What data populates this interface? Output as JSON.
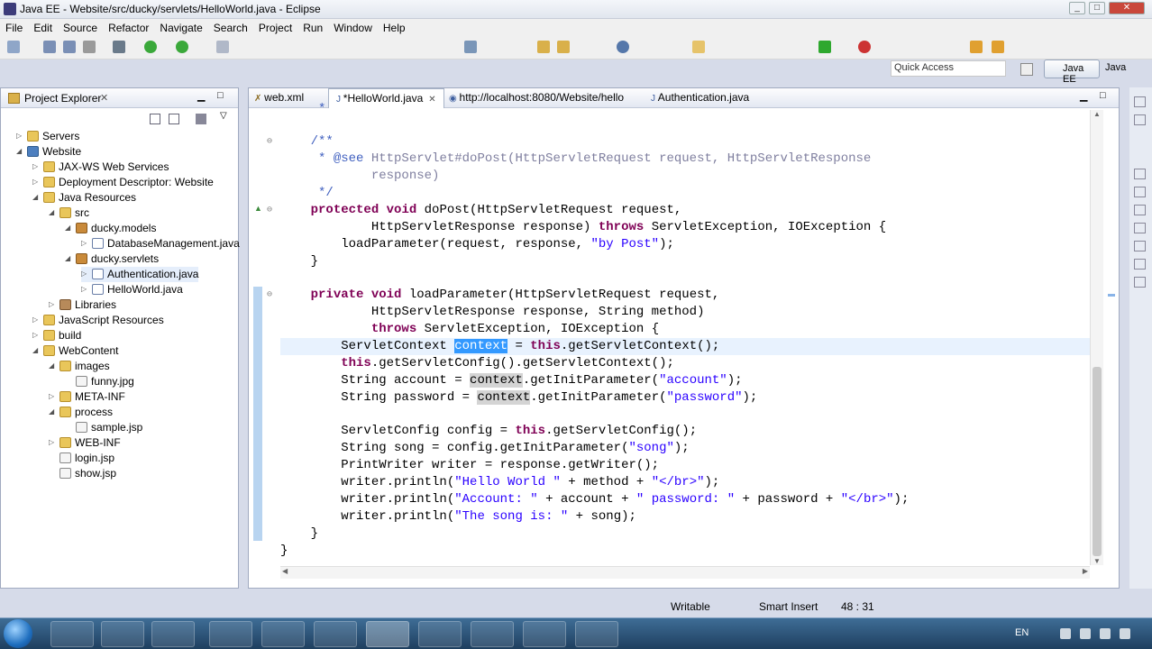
{
  "window": {
    "title": "Java EE - Website/src/ducky/servlets/HelloWorld.java - Eclipse"
  },
  "menu": [
    "File",
    "Edit",
    "Source",
    "Refactor",
    "Navigate",
    "Search",
    "Project",
    "Run",
    "Window",
    "Help"
  ],
  "quick_access": {
    "placeholder": "Quick Access"
  },
  "perspective": {
    "active": "Java EE",
    "other": "Java"
  },
  "explorer": {
    "title": "Project Explorer",
    "nodes": [
      {
        "label": "Servers",
        "icon": "folder"
      },
      {
        "label": "Website",
        "icon": "project"
      },
      {
        "label": "JAX-WS Web Services",
        "icon": "folder"
      },
      {
        "label": "Deployment Descriptor: Website",
        "icon": "folder"
      },
      {
        "label": "Java Resources",
        "icon": "folder"
      },
      {
        "label": "src",
        "icon": "folder"
      },
      {
        "label": "ducky.models",
        "icon": "package"
      },
      {
        "label": "DatabaseManagement.java",
        "icon": "java-file"
      },
      {
        "label": "ducky.servlets",
        "icon": "package"
      },
      {
        "label": "Authentication.java",
        "icon": "java-file"
      },
      {
        "label": "HelloWorld.java",
        "icon": "java-file"
      },
      {
        "label": "Libraries",
        "icon": "library"
      },
      {
        "label": "JavaScript Resources",
        "icon": "folder"
      },
      {
        "label": "build",
        "icon": "folder"
      },
      {
        "label": "WebContent",
        "icon": "folder"
      },
      {
        "label": "images",
        "icon": "folder"
      },
      {
        "label": "funny.jpg",
        "icon": "image-file"
      },
      {
        "label": "META-INF",
        "icon": "folder"
      },
      {
        "label": "process",
        "icon": "folder"
      },
      {
        "label": "sample.jsp",
        "icon": "jsp-file"
      },
      {
        "label": "WEB-INF",
        "icon": "folder"
      },
      {
        "label": "login.jsp",
        "icon": "jsp-file"
      },
      {
        "label": "show.jsp",
        "icon": "jsp-file"
      }
    ]
  },
  "editor": {
    "tabs": [
      {
        "label": "web.xml"
      },
      {
        "label": "*HelloWorld.java",
        "active": true
      },
      {
        "label": "http://localhost:8080/Website/hello"
      },
      {
        "label": "Authentication.java"
      }
    ],
    "code": {
      "l1": "     *",
      "l2a": "/**",
      "l3a": " * @see ",
      "l3b": "HttpServlet#doPost(HttpServletRequest request, HttpServletResponse",
      "l4": "        response)",
      "l5": " */",
      "kw_protected": "protected",
      "kw_void": "void",
      "kw_private": "private",
      "kw_throws": "throws",
      "kw_this": "this",
      "l6rest": " doPost(HttpServletRequest request,",
      "l7a": "        HttpServletResponse response) ",
      "l7b": " ServletException, IOException {",
      "l8a": "    loadParameter(request, response, ",
      "l8s": "\"by Post\"",
      "l8b": ");",
      "brace": "}",
      "l10rest": " loadParameter(HttpServletRequest request,",
      "l11": "        HttpServletResponse response, String method)",
      "l12b": " ServletException, IOException {",
      "l13a": "    ServletContext ",
      "context": "context",
      "l13b": " = ",
      "l13c": ".getServletContext();",
      "l14b": ".getServletConfig().getServletContext();",
      "l15a": "    String account = ",
      "l15b": ".getInitParameter(",
      "s_account": "\"account\"",
      "paren_end": ");",
      "l16a": "    String password = ",
      "s_password": "\"password\"",
      "l18a": "    ServletConfig config = ",
      "l18b": ".getServletConfig();",
      "l19a": "    String song = config.getInitParameter(",
      "s_song": "\"song\"",
      "l20": "    PrintWriter writer = response.getWriter();",
      "l21a": "    writer.println(",
      "s_hello": "\"Hello World \"",
      "l21b": " + method + ",
      "s_br": "\"</br>\"",
      "s_account_lbl": "\"Account: \"",
      "l22b": " + account + ",
      "s_password_lbl": "\" password: \"",
      "l22c": " + password + ",
      "s_song_lbl": "\"The song is: \"",
      "l23b": " + song);"
    }
  },
  "status": {
    "mode": "Writable",
    "insert": "Smart Insert",
    "position": "48 : 31"
  },
  "tray": {
    "lang": "EN"
  }
}
